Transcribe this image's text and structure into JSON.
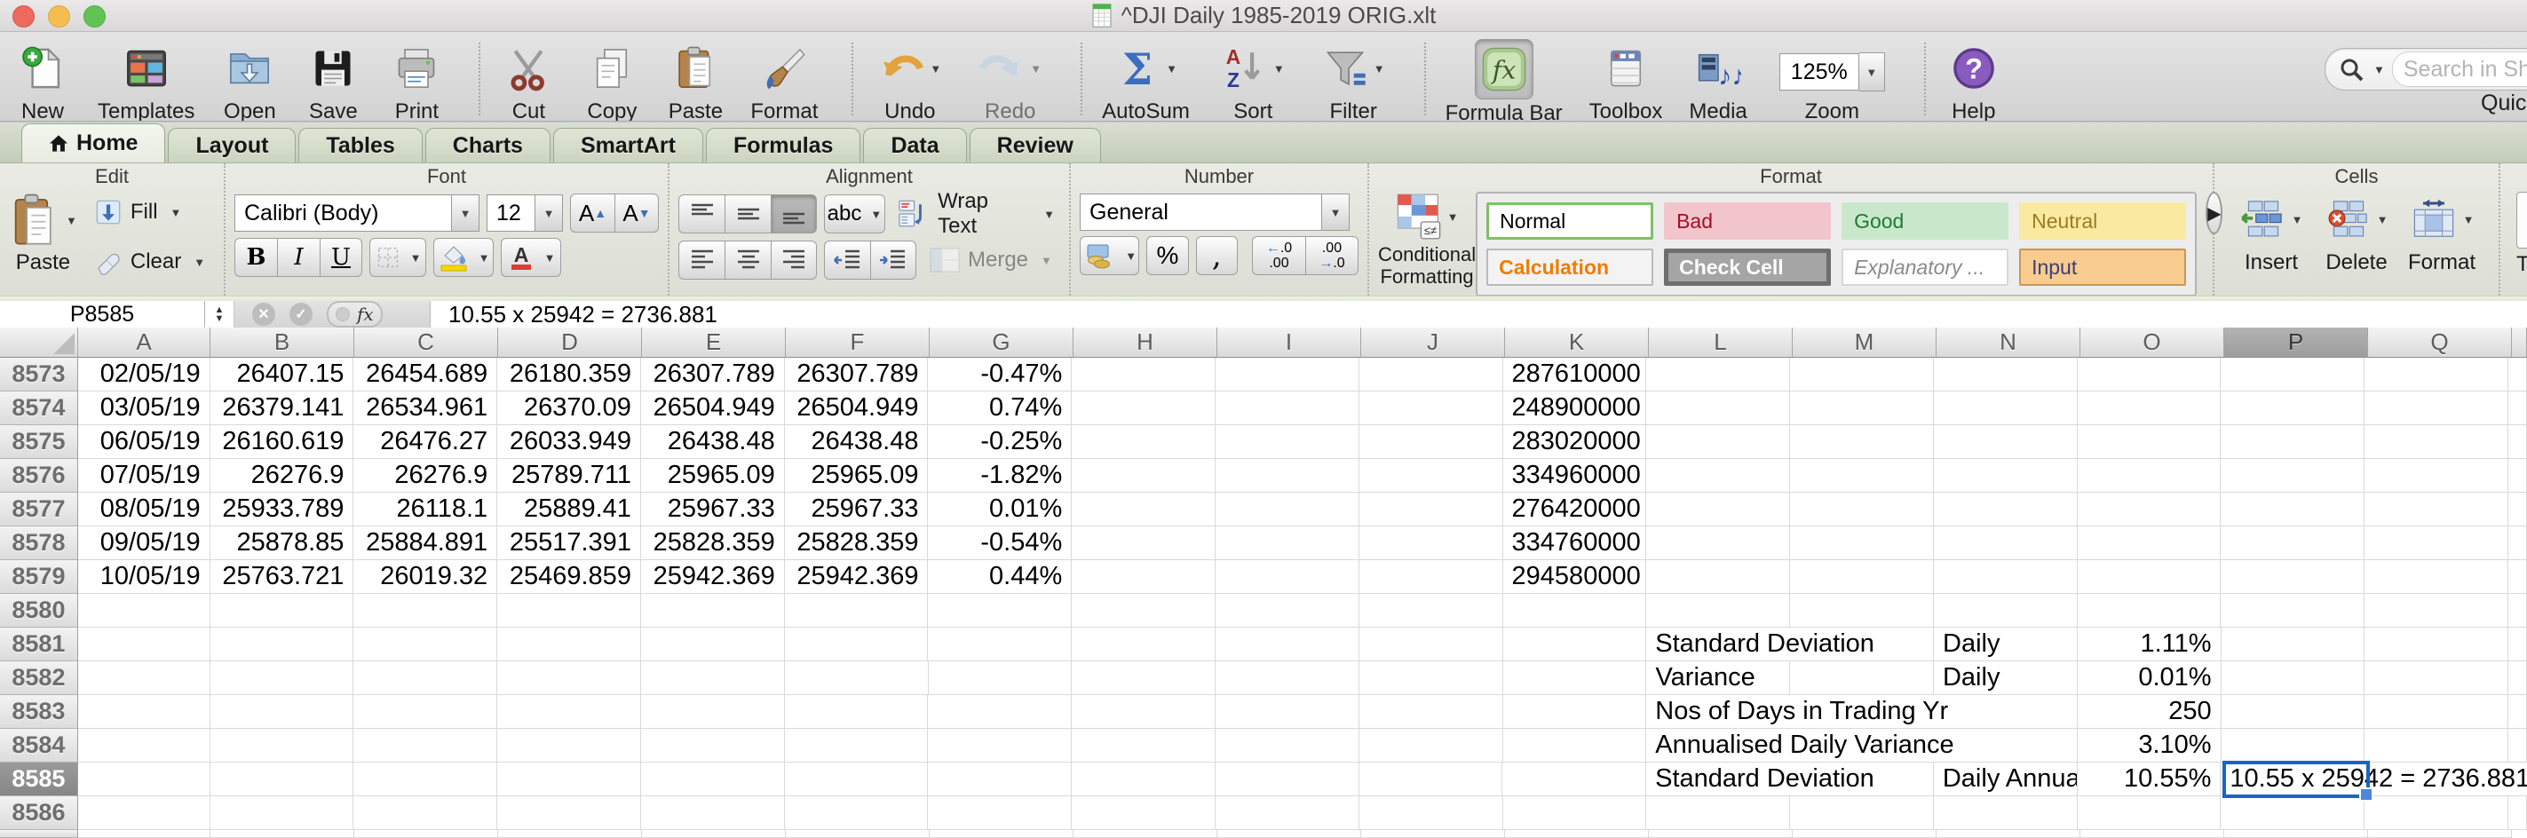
{
  "window": {
    "title": "^DJI Daily 1985-2019 ORIG.xlt"
  },
  "toolbar": {
    "items": [
      {
        "id": "new",
        "label": "New"
      },
      {
        "id": "templates",
        "label": "Templates"
      },
      {
        "id": "open",
        "label": "Open"
      },
      {
        "id": "save",
        "label": "Save"
      },
      {
        "id": "print",
        "label": "Print"
      },
      {
        "sep": true
      },
      {
        "id": "cut",
        "label": "Cut"
      },
      {
        "id": "copy",
        "label": "Copy"
      },
      {
        "id": "paste",
        "label": "Paste"
      },
      {
        "id": "format",
        "label": "Format"
      },
      {
        "sep": true
      },
      {
        "id": "undo",
        "label": "Undo",
        "dropdown": true
      },
      {
        "id": "redo",
        "label": "Redo",
        "dropdown": true,
        "disabled": true
      },
      {
        "sep": true
      },
      {
        "id": "autosum",
        "label": "AutoSum",
        "dropdown": true
      },
      {
        "id": "sort",
        "label": "Sort",
        "dropdown": true
      },
      {
        "id": "filter",
        "label": "Filter",
        "dropdown": true
      },
      {
        "sep": true
      },
      {
        "id": "formula-bar",
        "label": "Formula Bar",
        "pressed": true
      },
      {
        "id": "toolbox",
        "label": "Toolbox"
      },
      {
        "id": "media",
        "label": "Media"
      },
      {
        "id": "zoom",
        "label": "Zoom",
        "zoom_value": "125%"
      },
      {
        "sep": true
      },
      {
        "id": "help",
        "label": "Help"
      }
    ],
    "search": {
      "placeholder": "Search in Shee"
    },
    "quick_label": "Quick"
  },
  "tabs": [
    {
      "label": "Home",
      "active": true
    },
    {
      "label": "Layout"
    },
    {
      "label": "Tables"
    },
    {
      "label": "Charts"
    },
    {
      "label": "SmartArt"
    },
    {
      "label": "Formulas"
    },
    {
      "label": "Data"
    },
    {
      "label": "Review"
    }
  ],
  "ribbon": {
    "groups": {
      "edit": "Edit",
      "font": "Font",
      "alignment": "Alignment",
      "number": "Number",
      "format": "Format",
      "cells": "Cells"
    },
    "edit": {
      "paste": "Paste",
      "fill": "Fill",
      "clear": "Clear"
    },
    "font": {
      "family": "Calibri (Body)",
      "size": "12",
      "bold": "B",
      "italic": "I",
      "underline": "U"
    },
    "alignment": {
      "abc": "abc",
      "wrap": "Wrap Text",
      "merge": "Merge"
    },
    "number": {
      "format": "General"
    },
    "format": {
      "conditional": "Conditional Formatting",
      "styles": [
        {
          "label": "Normal",
          "style": "normal"
        },
        {
          "label": "Bad",
          "style": "bad"
        },
        {
          "label": "Good",
          "style": "good"
        },
        {
          "label": "Neutral",
          "style": "neutral"
        },
        {
          "label": "Calculation",
          "style": "calculation"
        },
        {
          "label": "Check Cell",
          "style": "check"
        },
        {
          "label": "Explanatory ...",
          "style": "explanatory"
        },
        {
          "label": "Input",
          "style": "input"
        }
      ]
    },
    "cells": {
      "insert": "Insert",
      "delete": "Delete",
      "format": "Format"
    },
    "partial_group": "T"
  },
  "formula_bar": {
    "cell_ref": "P8585",
    "formula": "10.55 x 25942 = 2736.881"
  },
  "grid": {
    "columns": [
      "A",
      "B",
      "C",
      "D",
      "E",
      "F",
      "G",
      "H",
      "I",
      "J",
      "K",
      "L",
      "M",
      "N",
      "O",
      "P",
      "Q"
    ],
    "selected_column": "P",
    "selected_row": "8585",
    "rows": [
      {
        "n": "8573",
        "cells": [
          {
            "c": "A",
            "t": "02/05/19",
            "a": "r"
          },
          {
            "c": "B",
            "t": "26407.15",
            "a": "r"
          },
          {
            "c": "C",
            "t": "26454.689",
            "a": "r"
          },
          {
            "c": "D",
            "t": "26180.359",
            "a": "r"
          },
          {
            "c": "E",
            "t": "26307.789",
            "a": "r"
          },
          {
            "c": "F",
            "t": "26307.789",
            "a": "r"
          },
          {
            "c": "G",
            "t": "-0.47%",
            "a": "r"
          },
          {
            "c": "K",
            "t": "287610000",
            "a": "r"
          }
        ]
      },
      {
        "n": "8574",
        "cells": [
          {
            "c": "A",
            "t": "03/05/19",
            "a": "r"
          },
          {
            "c": "B",
            "t": "26379.141",
            "a": "r"
          },
          {
            "c": "C",
            "t": "26534.961",
            "a": "r"
          },
          {
            "c": "D",
            "t": "26370.09",
            "a": "r"
          },
          {
            "c": "E",
            "t": "26504.949",
            "a": "r"
          },
          {
            "c": "F",
            "t": "26504.949",
            "a": "r"
          },
          {
            "c": "G",
            "t": "0.74%",
            "a": "r"
          },
          {
            "c": "K",
            "t": "248900000",
            "a": "r"
          }
        ]
      },
      {
        "n": "8575",
        "cells": [
          {
            "c": "A",
            "t": "06/05/19",
            "a": "r"
          },
          {
            "c": "B",
            "t": "26160.619",
            "a": "r"
          },
          {
            "c": "C",
            "t": "26476.27",
            "a": "r"
          },
          {
            "c": "D",
            "t": "26033.949",
            "a": "r"
          },
          {
            "c": "E",
            "t": "26438.48",
            "a": "r"
          },
          {
            "c": "F",
            "t": "26438.48",
            "a": "r"
          },
          {
            "c": "G",
            "t": "-0.25%",
            "a": "r"
          },
          {
            "c": "K",
            "t": "283020000",
            "a": "r"
          }
        ]
      },
      {
        "n": "8576",
        "cells": [
          {
            "c": "A",
            "t": "07/05/19",
            "a": "r"
          },
          {
            "c": "B",
            "t": "26276.9",
            "a": "r"
          },
          {
            "c": "C",
            "t": "26276.9",
            "a": "r"
          },
          {
            "c": "D",
            "t": "25789.711",
            "a": "r"
          },
          {
            "c": "E",
            "t": "25965.09",
            "a": "r"
          },
          {
            "c": "F",
            "t": "25965.09",
            "a": "r"
          },
          {
            "c": "G",
            "t": "-1.82%",
            "a": "r"
          },
          {
            "c": "K",
            "t": "334960000",
            "a": "r"
          }
        ]
      },
      {
        "n": "8577",
        "cells": [
          {
            "c": "A",
            "t": "08/05/19",
            "a": "r"
          },
          {
            "c": "B",
            "t": "25933.789",
            "a": "r"
          },
          {
            "c": "C",
            "t": "26118.1",
            "a": "r"
          },
          {
            "c": "D",
            "t": "25889.41",
            "a": "r"
          },
          {
            "c": "E",
            "t": "25967.33",
            "a": "r"
          },
          {
            "c": "F",
            "t": "25967.33",
            "a": "r"
          },
          {
            "c": "G",
            "t": "0.01%",
            "a": "r"
          },
          {
            "c": "K",
            "t": "276420000",
            "a": "r"
          }
        ]
      },
      {
        "n": "8578",
        "cells": [
          {
            "c": "A",
            "t": "09/05/19",
            "a": "r"
          },
          {
            "c": "B",
            "t": "25878.85",
            "a": "r"
          },
          {
            "c": "C",
            "t": "25884.891",
            "a": "r"
          },
          {
            "c": "D",
            "t": "25517.391",
            "a": "r"
          },
          {
            "c": "E",
            "t": "25828.359",
            "a": "r"
          },
          {
            "c": "F",
            "t": "25828.359",
            "a": "r"
          },
          {
            "c": "G",
            "t": "-0.54%",
            "a": "r"
          },
          {
            "c": "K",
            "t": "334760000",
            "a": "r"
          }
        ]
      },
      {
        "n": "8579",
        "cells": [
          {
            "c": "A",
            "t": "10/05/19",
            "a": "r"
          },
          {
            "c": "B",
            "t": "25763.721",
            "a": "r"
          },
          {
            "c": "C",
            "t": "26019.32",
            "a": "r"
          },
          {
            "c": "D",
            "t": "25469.859",
            "a": "r"
          },
          {
            "c": "E",
            "t": "25942.369",
            "a": "r"
          },
          {
            "c": "F",
            "t": "25942.369",
            "a": "r"
          },
          {
            "c": "G",
            "t": "0.44%",
            "a": "r"
          },
          {
            "c": "K",
            "t": "294580000",
            "a": "r"
          }
        ]
      },
      {
        "n": "8580",
        "cells": []
      },
      {
        "n": "8581",
        "cells": [
          {
            "c": "L",
            "t": "Standard Deviation",
            "a": "l",
            "spill": true
          },
          {
            "c": "N",
            "t": "Daily",
            "a": "l"
          },
          {
            "c": "O",
            "t": "1.11%",
            "a": "r"
          }
        ]
      },
      {
        "n": "8582",
        "cells": [
          {
            "c": "L",
            "t": "Variance",
            "a": "l",
            "spill": true
          },
          {
            "c": "N",
            "t": "Daily",
            "a": "l"
          },
          {
            "c": "O",
            "t": "0.01%",
            "a": "r"
          }
        ]
      },
      {
        "n": "8583",
        "cells": [
          {
            "c": "L",
            "t": "Nos of Days in Trading Yr",
            "a": "l",
            "spill": true
          },
          {
            "c": "O",
            "t": "250",
            "a": "r"
          }
        ]
      },
      {
        "n": "8584",
        "cells": [
          {
            "c": "L",
            "t": "Annualised Daily Variance",
            "a": "l",
            "spill": true
          },
          {
            "c": "O",
            "t": "3.10%",
            "a": "r"
          }
        ]
      },
      {
        "n": "8585",
        "selected": true,
        "cells": [
          {
            "c": "L",
            "t": "Standard Deviation",
            "a": "l",
            "spill": true
          },
          {
            "c": "N",
            "t": "Daily Annuali",
            "a": "l",
            "clip": true
          },
          {
            "c": "O",
            "t": "10.55%",
            "a": "r"
          },
          {
            "c": "P",
            "t": "10.55 x 25942 = 2736.881",
            "a": "l",
            "spill": true,
            "selected": true
          }
        ]
      },
      {
        "n": "8586",
        "cells": []
      }
    ]
  }
}
